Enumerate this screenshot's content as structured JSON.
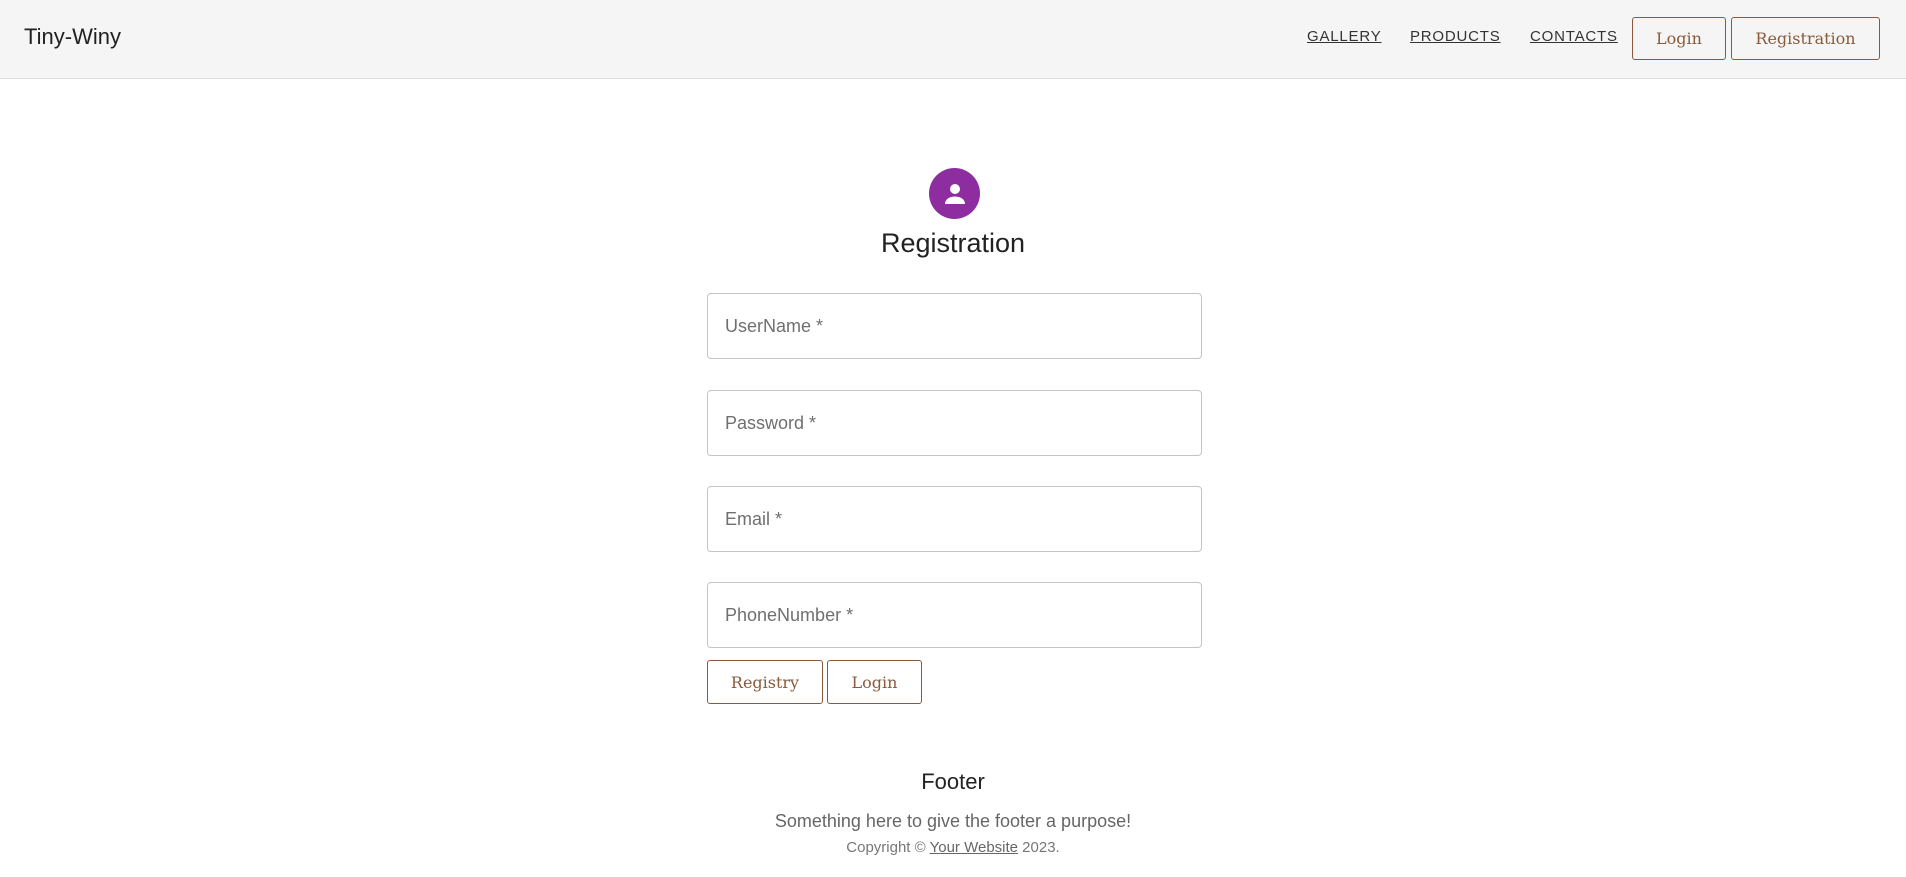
{
  "header": {
    "brand": "Tiny-Winy",
    "nav": {
      "gallery": "GALLERY",
      "products": "PRODUCTS",
      "contacts": "CONTACTS"
    },
    "login_button": "Login",
    "registration_button": "Registration"
  },
  "form": {
    "title": "Registration",
    "icon": "person-icon",
    "fields": {
      "username_placeholder": "UserName *",
      "password_placeholder": "Password *",
      "email_placeholder": "Email *",
      "phone_placeholder": "PhoneNumber *"
    },
    "registry_button": "Registry",
    "login_button": "Login"
  },
  "footer": {
    "title": "Footer",
    "text": "Something here to give the footer a purpose!",
    "copyright_prefix": "Copyright ©",
    "link": "Your Website",
    "year": "2023."
  },
  "colors": {
    "accent_brown": "#8a5a3a",
    "avatar_purple": "#8e2d9f",
    "header_bg": "#f5f5f5"
  }
}
